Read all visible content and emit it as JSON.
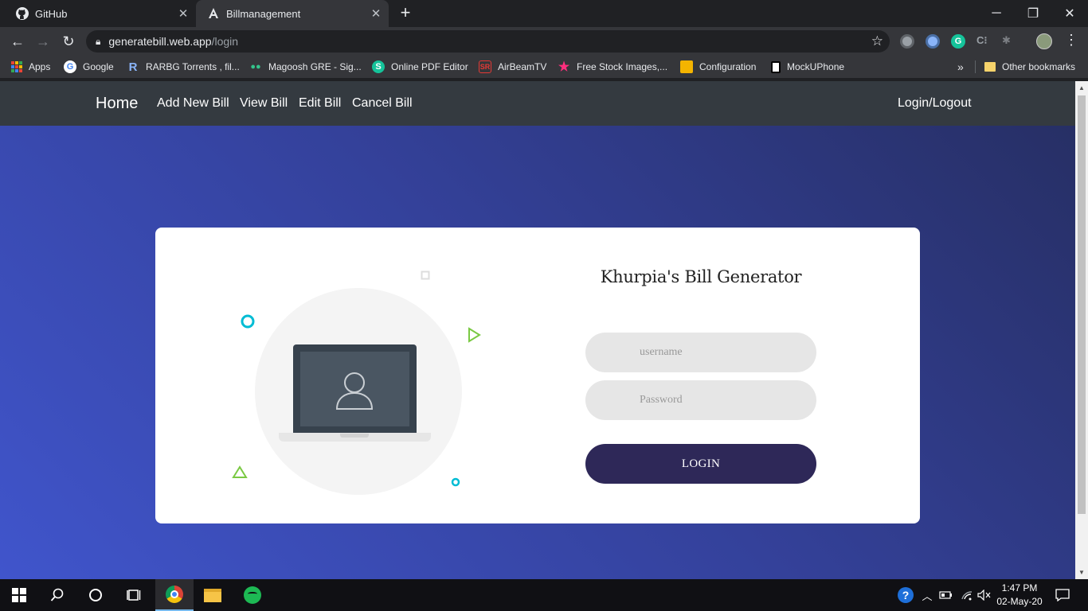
{
  "browser": {
    "tabs": [
      {
        "title": "GitHub"
      },
      {
        "title": "Billmanagement"
      }
    ],
    "url_host": "generatebill.web.app",
    "url_path": "/login",
    "bookmarks": [
      {
        "label": "Apps"
      },
      {
        "label": "Google"
      },
      {
        "label": "RARBG Torrents , fil..."
      },
      {
        "label": "Magoosh GRE - Sig..."
      },
      {
        "label": "Online PDF Editor"
      },
      {
        "label": "AirBeamTV"
      },
      {
        "label": "Free Stock Images,..."
      },
      {
        "label": "Configuration"
      },
      {
        "label": "MockUPhone"
      }
    ],
    "bookmarks_overflow": "»",
    "other_bookmarks": "Other bookmarks"
  },
  "site_nav": {
    "home": "Home",
    "add_new_bill": "Add New Bill",
    "view_bill": "View Bill",
    "edit_bill": "Edit Bill",
    "cancel_bill": "Cancel Bill",
    "login_logout": "Login/Logout"
  },
  "login_card": {
    "title": "Khurpia's Bill Generator",
    "username_placeholder": "username",
    "password_placeholder": "Password",
    "login_button": "LOGIN"
  },
  "taskbar": {
    "time": "1:47 PM",
    "date": "02-May-20"
  },
  "colors": {
    "nav_bg": "#343a40",
    "button_bg": "#2e2858",
    "input_bg": "#e6e6e6",
    "accent_cyan": "#00bcd4",
    "accent_green": "#7ac943"
  }
}
